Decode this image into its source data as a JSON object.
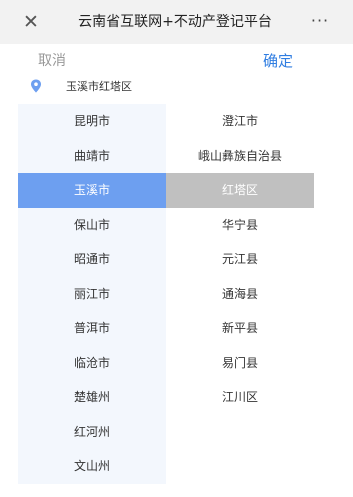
{
  "header": {
    "title": "云南省互联网+不动产登记平台",
    "close_icon": "close-icon",
    "more_icon": "more-icon"
  },
  "actions": {
    "cancel": "取消",
    "confirm": "确定"
  },
  "selection": {
    "icon": "location-pin-icon",
    "text": "玉溪市红塔区",
    "icon_color": "#6d9ff0"
  },
  "cities": [
    {
      "label": "昆明市",
      "active": false
    },
    {
      "label": "曲靖市",
      "active": false
    },
    {
      "label": "玉溪市",
      "active": true
    },
    {
      "label": "保山市",
      "active": false
    },
    {
      "label": "昭通市",
      "active": false
    },
    {
      "label": "丽江市",
      "active": false
    },
    {
      "label": "普洱市",
      "active": false
    },
    {
      "label": "临沧市",
      "active": false
    },
    {
      "label": "楚雄州",
      "active": false
    },
    {
      "label": "红河州",
      "active": false
    },
    {
      "label": "文山州",
      "active": false
    }
  ],
  "districts": [
    {
      "label": "澄江市",
      "active": false
    },
    {
      "label": "峨山彝族自治县",
      "active": false
    },
    {
      "label": "红塔区",
      "active": true
    },
    {
      "label": "华宁县",
      "active": false
    },
    {
      "label": "元江县",
      "active": false
    },
    {
      "label": "通海县",
      "active": false
    },
    {
      "label": "新平县",
      "active": false
    },
    {
      "label": "易门县",
      "active": false
    },
    {
      "label": "江川区",
      "active": false
    }
  ],
  "colors": {
    "accent": "#2f7de1",
    "city_active_bg": "#6d9ff0",
    "district_active_bg": "#c0c0c0"
  }
}
